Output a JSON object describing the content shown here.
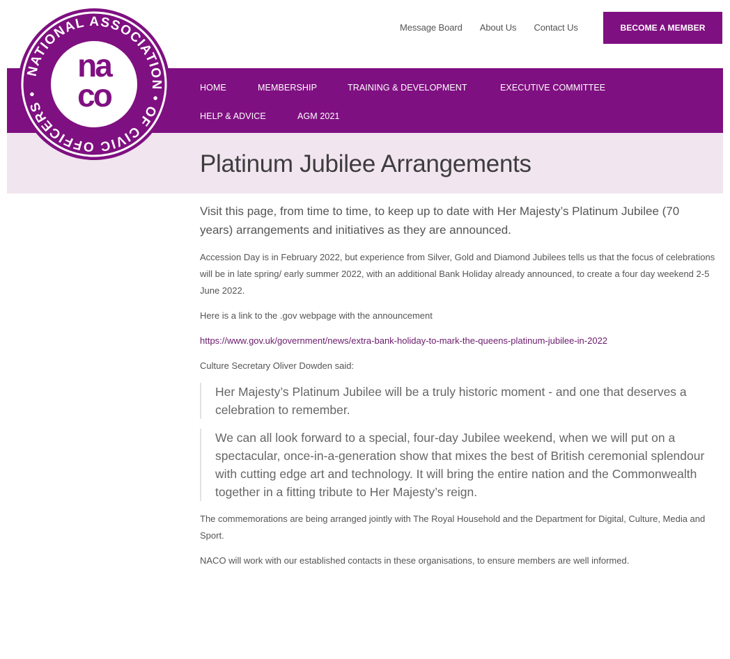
{
  "logo": {
    "ring_text": "NATIONAL ASSOCIATION • OF CIVIC OFFICERS •",
    "mark": "naco"
  },
  "top_nav": {
    "links": [
      "Message Board",
      "About Us",
      "Contact Us"
    ],
    "cta": "BECOME A MEMBER"
  },
  "main_nav": {
    "items": [
      "HOME",
      "MEMBERSHIP",
      "TRAINING & DEVELOPMENT",
      "EXECUTIVE COMMITTEE",
      "HELP & ADVICE",
      "AGM 2021"
    ]
  },
  "page": {
    "title": "Platinum Jubilee Arrangements",
    "intro": "Visit this page, from time to time, to keep up to date with Her Majesty’s Platinum Jubilee (70 years) arrangements and initiatives as they are announced.",
    "para1": "Accession Day is in February 2022, but experience from Silver, Gold and Diamond Jubilees tells us that the focus of celebrations will be in late spring/ early summer 2022, with an additional Bank Holiday already announced, to create a four day weekend 2-5 June 2022.",
    "para2": "Here is a link to the .gov webpage with the announcement",
    "link": "https://www.gov.uk/government/news/extra-bank-holiday-to-mark-the-queens-platinum-jubilee-in-2022",
    "para3": "Culture Secretary Oliver Dowden said:",
    "quote1": "Her Majesty’s Platinum Jubilee will be a truly historic moment - and one that deserves a celebration to remember.",
    "quote2": "We can all look forward to a special, four-day Jubilee weekend, when we will put on a spectacular, once-in-a-generation show that mixes the best of British ceremonial splendour with cutting edge art and technology. It will bring the entire nation and the Commonwealth together in a fitting tribute to Her Majesty’s reign.",
    "para4": "The commemorations are being arranged jointly with The Royal Household and the Department for Digital, Culture, Media and Sport.",
    "para5": "NACO will work with our established contacts in these organisations, to ensure members are well informed."
  },
  "colors": {
    "brand_purple": "#7f1081",
    "title_band": "#f1e5f0",
    "link": "#6a1b6c"
  }
}
